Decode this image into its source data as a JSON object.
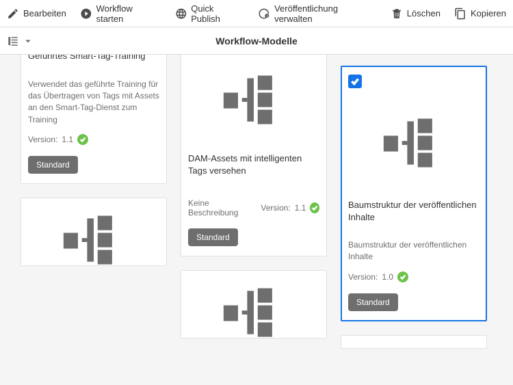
{
  "toolbar": {
    "edit": "Bearbeiten",
    "startWorkflow": "Workflow starten",
    "quickPublish": "Quick Publish",
    "managePublication": "Veröffentlichung verwalten",
    "delete": "Löschen",
    "copy": "Kopieren"
  },
  "pageTitle": "Workflow-Modelle",
  "cards": [
    {
      "title": "Geführtes Smart-Tag-Training",
      "description": "Verwendet das geführte Training für das Übertragen von Tags mit Assets an den Smart-Tag-Dienst zum Training",
      "versionLabel": "Version:",
      "version": "1.1",
      "tag": "Standard"
    },
    {
      "title": "DAM-Assets mit intelligenten Tags versehen",
      "descPrefix": "Keine Beschreibung",
      "versionLabel": "Version:",
      "version": "1.1",
      "tag": "Standard"
    },
    {
      "title": "Baumstruktur der veröffentlichen Inhalte",
      "description": "Baumstruktur der veröffentlichen Inhalte",
      "versionLabel": "Version:",
      "version": "1.0",
      "tag": "Standard"
    }
  ]
}
